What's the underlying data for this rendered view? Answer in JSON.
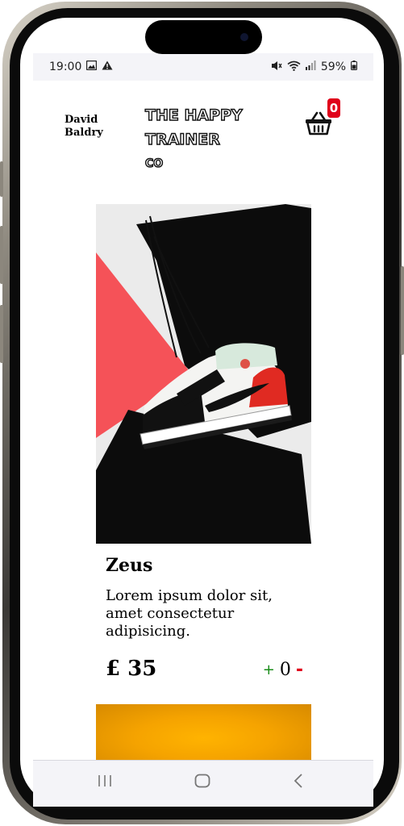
{
  "status_bar": {
    "time": "19:00",
    "battery": "59%",
    "icons": [
      "image-icon",
      "warning-icon",
      "mute-icon",
      "wifi-icon",
      "signal-icon",
      "battery-icon"
    ]
  },
  "header": {
    "user_name": "David Baldry",
    "brand_line1": "THE HAPPY",
    "brand_line2": "TRAINER",
    "brand_line3": "CO",
    "cart_count": "0"
  },
  "product": {
    "name": "Zeus",
    "description": "Lorem ipsum dolor sit, amet consectetur adipisicing.",
    "price": "£ 35",
    "qty_plus": "+",
    "quantity": "0",
    "qty_minus": "-"
  },
  "nav": {
    "icons": [
      "recent-apps-icon",
      "home-icon",
      "back-icon"
    ]
  },
  "colors": {
    "badge": "#e0001a",
    "plus": "#1a8d1a",
    "minus": "#e0001a",
    "next_product": "#f5a300"
  }
}
